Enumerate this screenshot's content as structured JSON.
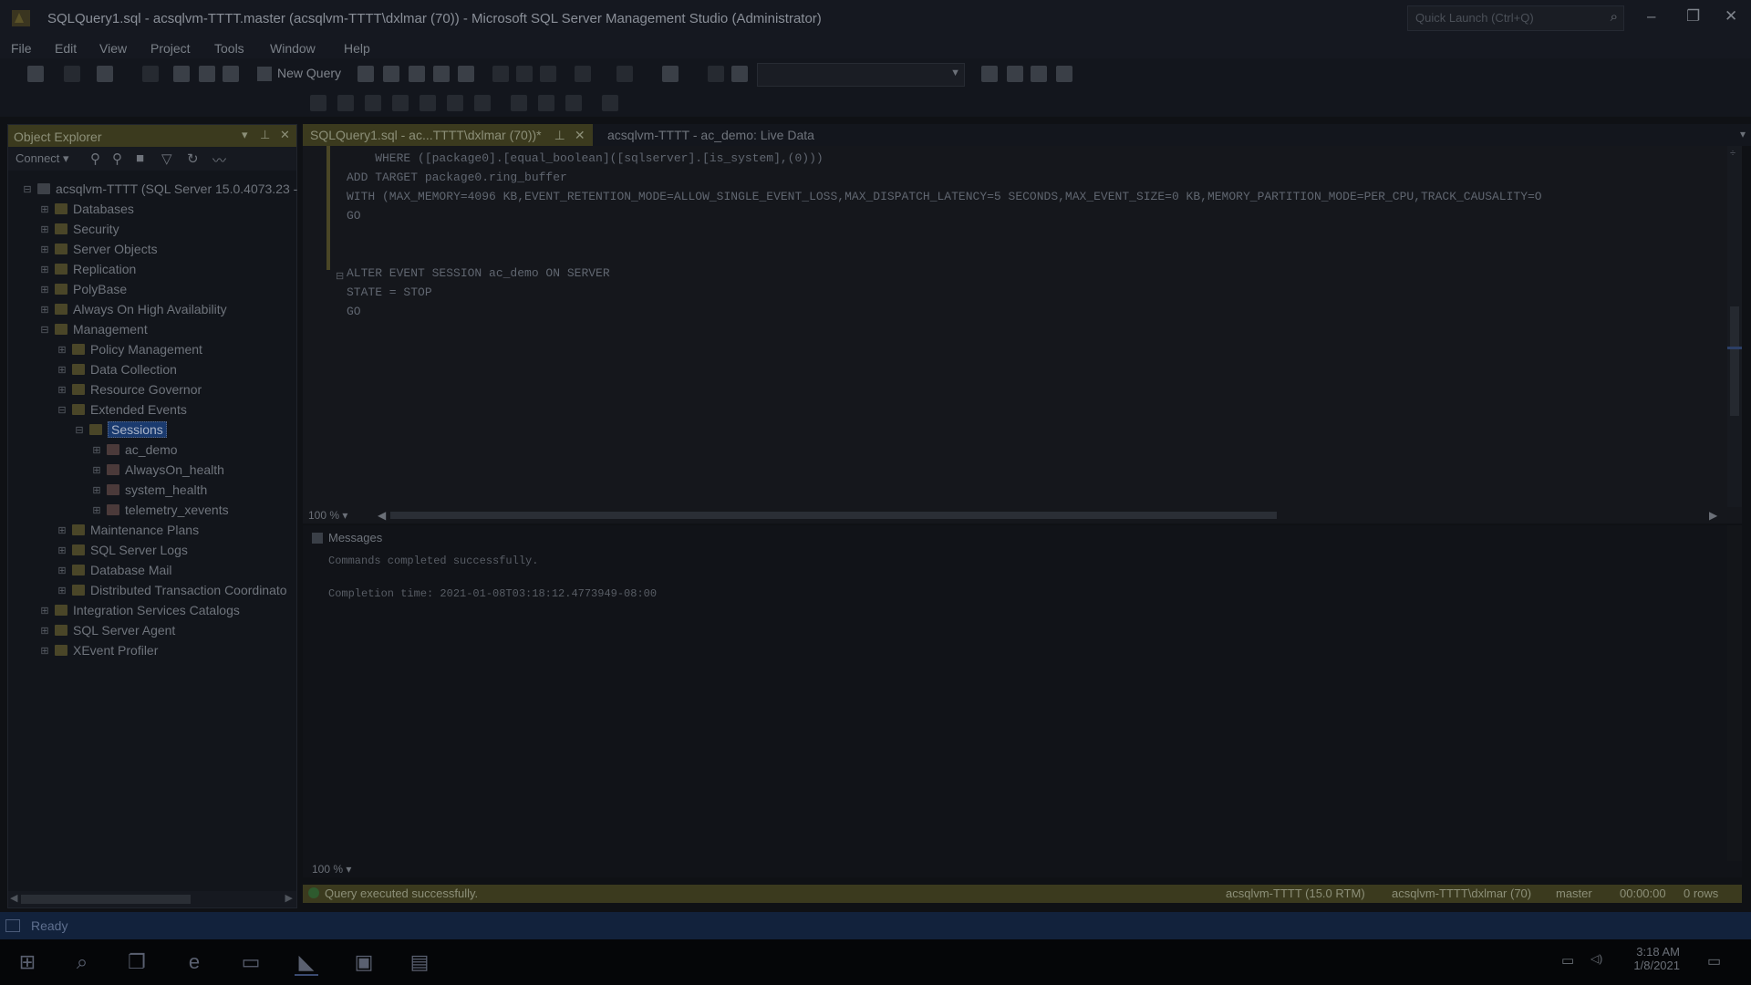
{
  "window": {
    "title": "SQLQuery1.sql - acsqlvm-TTTT.master (acsqlvm-TTTT\\dxlmar (70)) - Microsoft SQL Server Management Studio (Administrator)",
    "quick_launch_placeholder": "Quick Launch (Ctrl+Q)"
  },
  "menu": [
    "File",
    "Edit",
    "View",
    "Project",
    "Tools",
    "Window",
    "Help"
  ],
  "toolbar": {
    "new_query_label": "New Query"
  },
  "object_explorer": {
    "title": "Object Explorer",
    "connect_label": "Connect",
    "tree": [
      {
        "label": "acsqlvm-TTTT (SQL Server 15.0.4073.23 -",
        "level": 0,
        "icon": "server"
      },
      {
        "label": "Databases",
        "level": 1
      },
      {
        "label": "Security",
        "level": 1
      },
      {
        "label": "Server Objects",
        "level": 1
      },
      {
        "label": "Replication",
        "level": 1
      },
      {
        "label": "PolyBase",
        "level": 1
      },
      {
        "label": "Always On High Availability",
        "level": 1
      },
      {
        "label": "Management",
        "level": 1
      },
      {
        "label": "Policy Management",
        "level": 2
      },
      {
        "label": "Data Collection",
        "level": 2
      },
      {
        "label": "Resource Governor",
        "level": 2
      },
      {
        "label": "Extended Events",
        "level": 2
      },
      {
        "label": "Sessions",
        "level": 3,
        "selected": true
      },
      {
        "label": "ac_demo",
        "level": 4,
        "icon": "session"
      },
      {
        "label": "AlwaysOn_health",
        "level": 4,
        "icon": "session"
      },
      {
        "label": "system_health",
        "level": 4,
        "icon": "session"
      },
      {
        "label": "telemetry_xevents",
        "level": 4,
        "icon": "session"
      },
      {
        "label": "Maintenance Plans",
        "level": 2
      },
      {
        "label": "SQL Server Logs",
        "level": 2
      },
      {
        "label": "Database Mail",
        "level": 2
      },
      {
        "label": "Distributed Transaction Coordinato",
        "level": 2
      },
      {
        "label": "Integration Services Catalogs",
        "level": 1
      },
      {
        "label": "SQL Server Agent",
        "level": 1
      },
      {
        "label": "XEvent Profiler",
        "level": 1
      }
    ]
  },
  "tabs": [
    {
      "label": "SQLQuery1.sql - ac...TTTT\\dxlmar (70))*",
      "active": true
    },
    {
      "label": "acsqlvm-TTTT - ac_demo: Live Data",
      "active": false
    }
  ],
  "editor": {
    "lines": [
      "    WHERE ([package0].[equal_boolean]([sqlserver].[is_system],(0)))",
      "ADD TARGET package0.ring_buffer",
      "WITH (MAX_MEMORY=4096 KB,EVENT_RETENTION_MODE=ALLOW_SINGLE_EVENT_LOSS,MAX_DISPATCH_LATENCY=5 SECONDS,MAX_EVENT_SIZE=0 KB,MEMORY_PARTITION_MODE=PER_CPU,TRACK_CAUSALITY=O",
      "GO",
      "",
      "",
      "ALTER EVENT SESSION ac_demo ON SERVER",
      "STATE = STOP",
      "GO"
    ],
    "zoom": "100 %"
  },
  "messages": {
    "tab_label": "Messages",
    "lines": [
      "Commands completed successfully.",
      "",
      "Completion time: 2021-01-08T03:18:12.4773949-08:00"
    ],
    "zoom": "100 %"
  },
  "query_status": {
    "message": "Query executed successfully.",
    "server": "acsqlvm-TTTT (15.0 RTM)",
    "user": "acsqlvm-TTTT\\dxlmar (70)",
    "database": "master",
    "elapsed": "00:00:00",
    "rows": "0 rows"
  },
  "app_status": "Ready",
  "taskbar": {
    "time": "3:18 AM",
    "date": "1/8/2021"
  },
  "colors": {
    "accent_yellow": "#3b3a1e",
    "selection": "#1a3a6e",
    "status_blue": "#12223c"
  }
}
